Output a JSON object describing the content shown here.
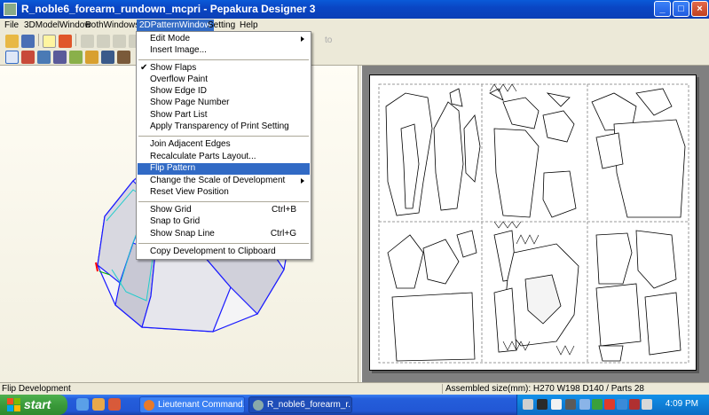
{
  "window": {
    "title": "R_noble6_forearm_rundown_mcpri - Pepakura Designer 3"
  },
  "menubar": {
    "items": [
      {
        "label": "File",
        "active": false
      },
      {
        "label": "3DModelWindow",
        "active": false
      },
      {
        "label": "BothWindows",
        "active": false
      },
      {
        "label": "2DPatternWindow",
        "active": true
      },
      {
        "label": "Setting",
        "active": false
      },
      {
        "label": "Help",
        "active": false
      }
    ]
  },
  "toolbar": {
    "ghost_text": "to"
  },
  "dropdown": {
    "items": [
      {
        "label": "Edit Mode",
        "submenu": true
      },
      {
        "label": "Insert Image..."
      },
      {
        "label": "Show Flaps",
        "checked": true
      },
      {
        "label": "Overflow Paint"
      },
      {
        "label": "Show Edge ID"
      },
      {
        "label": "Show Page Number"
      },
      {
        "label": "Show Part List"
      },
      {
        "label": "Apply Transparency of Print Setting"
      },
      {
        "label": "Join Adjacent Edges"
      },
      {
        "label": "Recalculate Parts Layout..."
      },
      {
        "label": "Flip Pattern",
        "highlighted": true
      },
      {
        "label": "Change the Scale of Development",
        "submenu": true
      },
      {
        "label": "Reset View Position"
      },
      {
        "label": "Show Grid",
        "shortcut": "Ctrl+B"
      },
      {
        "label": "Snap to Grid"
      },
      {
        "label": "Show Snap Line",
        "shortcut": "Ctrl+G"
      },
      {
        "label": "Copy Development to Clipboard"
      }
    ]
  },
  "statusbar": {
    "left": "Flip Development",
    "right": "Assembled size(mm): H270 W198 D140 / Parts 28"
  },
  "taskbar": {
    "start_label": "start",
    "tasks": [
      {
        "label": "Lieutenant Command..."
      },
      {
        "label": "R_noble6_forearm_r..."
      }
    ],
    "clock": "4:09 PM"
  },
  "colors": {
    "title_blue": "#0a46c4",
    "menu_highlight": "#316ac5",
    "taskbar_blue": "#245edb",
    "start_green": "#3a9a3a"
  }
}
